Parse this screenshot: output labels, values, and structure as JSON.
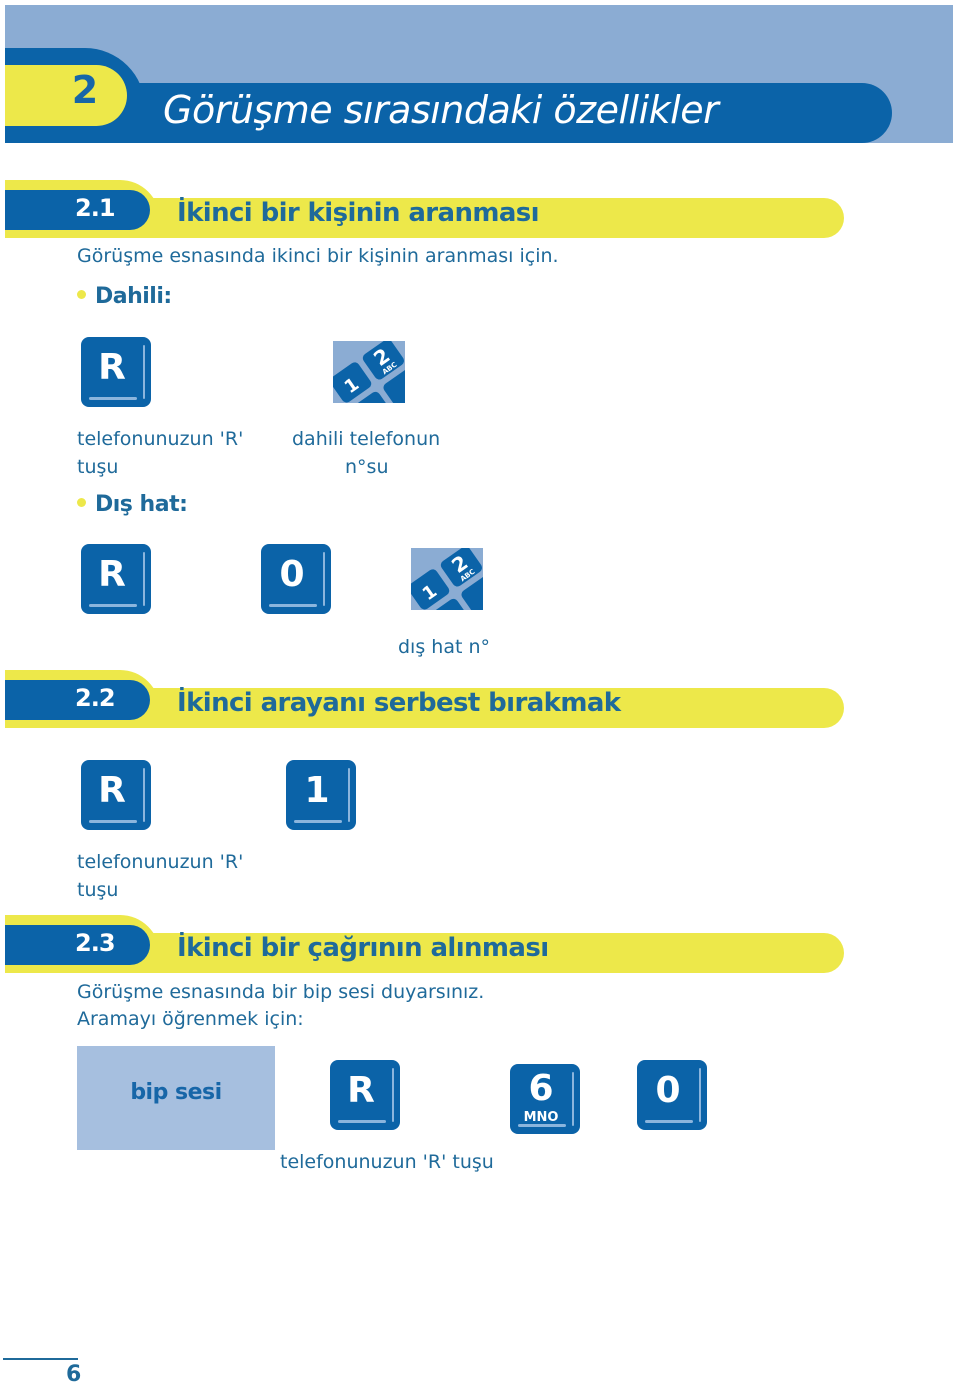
{
  "chapter": {
    "number": "2",
    "title": "Görüşme sırasındaki özellikler"
  },
  "sections": [
    {
      "number": "2.1",
      "title": "İkinci bir kişinin aranması",
      "intro": "Görüşme esnasında ikinci bir kişinin aranması için.",
      "internal": {
        "label": "Dahili:",
        "keys": [
          {
            "label": "R",
            "type": "key"
          },
          {
            "type": "keypad-icon",
            "digits": [
              "1",
              "2"
            ],
            "letters": "ABC"
          }
        ],
        "captions": {
          "r_key_line1": "telefonunuzun 'R'",
          "r_key_line2": "tuşu",
          "keypad_line1": "dahili telefonun",
          "keypad_line2": "n°su"
        }
      },
      "external": {
        "label": "Dış hat:",
        "keys": [
          {
            "label": "R",
            "type": "key"
          },
          {
            "label": "0",
            "type": "key"
          },
          {
            "type": "keypad-icon",
            "digits": [
              "1",
              "2"
            ],
            "letters": "ABC"
          }
        ],
        "captions": {
          "keypad": "dış hat n°"
        }
      }
    },
    {
      "number": "2.2",
      "title": "İkinci arayanı serbest bırakmak",
      "keys": [
        {
          "label": "R",
          "type": "key"
        },
        {
          "label": "1",
          "type": "key"
        }
      ],
      "captions": {
        "r_key_line1": "telefonunuzun 'R'",
        "r_key_line2": "tuşu"
      }
    },
    {
      "number": "2.3",
      "title": "İkinci bir çağrının alınması",
      "intro_line1": "Görüşme esnasında bir bip sesi duyarsınız.",
      "intro_line2": "Aramayı öğrenmek için:",
      "beep_label": "bip sesi",
      "keys": [
        {
          "label": "R",
          "type": "key"
        },
        {
          "label": "6",
          "sub": "MNO",
          "type": "key"
        },
        {
          "label": "0",
          "type": "key"
        }
      ],
      "captions": {
        "r_key": "telefonunuzun 'R' tuşu"
      }
    }
  ],
  "page_number": "6",
  "colors": {
    "primary_blue": "#0b63a8",
    "light_blue": "#8bacd3",
    "yellow": "#ede84a",
    "text_blue": "#1f6a9a"
  }
}
